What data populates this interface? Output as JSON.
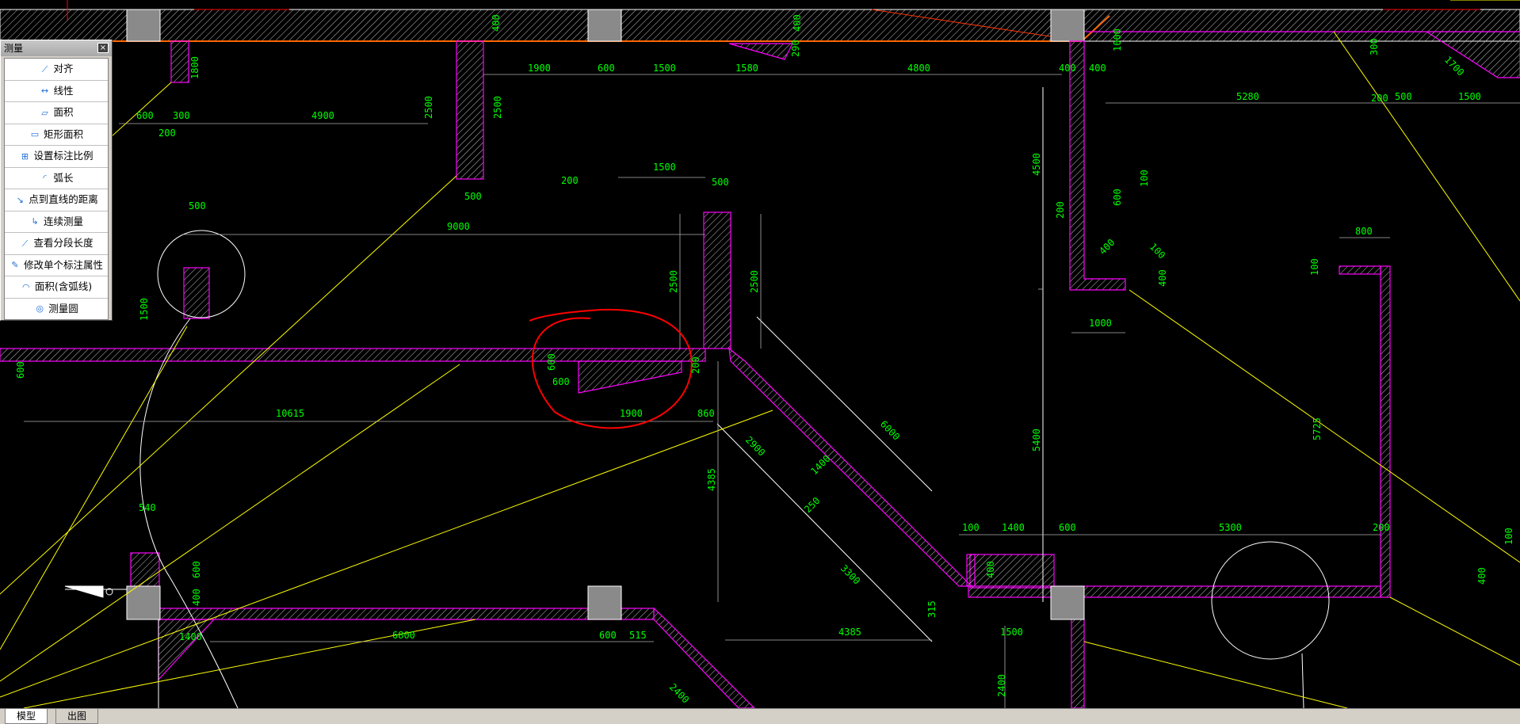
{
  "colors": {
    "dimension": "#00ff00",
    "wall_outline": "#ff00ff",
    "leader": "#ffff00",
    "markup": "#ff0000",
    "axis": "#ff6600"
  },
  "panel": {
    "title": "测量",
    "close": "×",
    "items": [
      {
        "label": "对齐",
        "icon": "align-icon"
      },
      {
        "label": "线性",
        "icon": "linear-icon"
      },
      {
        "label": "面积",
        "icon": "area-icon"
      },
      {
        "label": "矩形面积",
        "icon": "rect-area-icon"
      },
      {
        "label": "设置标注比例",
        "icon": "scale-icon"
      },
      {
        "label": "弧长",
        "icon": "arc-icon"
      },
      {
        "label": "点到直线的距离",
        "icon": "point-line-icon"
      },
      {
        "label": "连续测量",
        "icon": "continuous-icon"
      },
      {
        "label": "查看分段长度",
        "icon": "segment-icon"
      },
      {
        "label": "修改单个标注属性",
        "icon": "edit-dim-icon"
      },
      {
        "label": "面积(含弧线)",
        "icon": "arc-area-icon"
      },
      {
        "label": "测量圆",
        "icon": "circle-icon"
      }
    ]
  },
  "tabs": {
    "model": "模型",
    "layout": "出图"
  },
  "dims": {
    "d1": "1900",
    "d2": "600",
    "d3": "1500",
    "d4": "1580",
    "d5": "4800",
    "d6": "5280",
    "d7": "500",
    "d8": "1500",
    "d9": "200",
    "d10": "600",
    "d11": "300",
    "d12": "4900",
    "d13": "200",
    "d14": "2500",
    "d15": "2500",
    "d16": "500",
    "d17": "9000",
    "d18": "500",
    "d19": "1500",
    "d20": "500",
    "d21": "2500",
    "d22": "2500",
    "d23": "1500",
    "d24": "10615",
    "d25": "1900",
    "d26": "860",
    "d27": "600",
    "d28": "200",
    "d29": "4385",
    "d30": "2900",
    "d31": "6000",
    "d32": "3300",
    "d33": "4385",
    "d34": "1500",
    "d35": "100",
    "d36": "1400",
    "d37": "600",
    "d38": "5300",
    "d39": "200",
    "d40": "5400",
    "d41": "4500",
    "d42": "1000",
    "d43": "400",
    "d44": "800",
    "d45": "5725",
    "d46": "400",
    "d47": "6800",
    "d48": "600",
    "d49": "515",
    "d50": "2400",
    "d51": "540",
    "d52": "600",
    "d53": "400",
    "d54": "1400",
    "d55": "2400",
    "d56": "100",
    "d57": "400",
    "d58": "1800",
    "d59": "1000",
    "d60": "200",
    "d61": "100",
    "d62": "400",
    "d63": "1700",
    "d64": "300",
    "d65": "290",
    "d66": "400",
    "d67": "400",
    "d68": "600",
    "d69": "200",
    "d70": "600",
    "d71": "100",
    "d72": "1400",
    "d73": "315",
    "d74": "250",
    "d75": "100",
    "d76": "400",
    "d77": "600",
    "d78": "400"
  }
}
